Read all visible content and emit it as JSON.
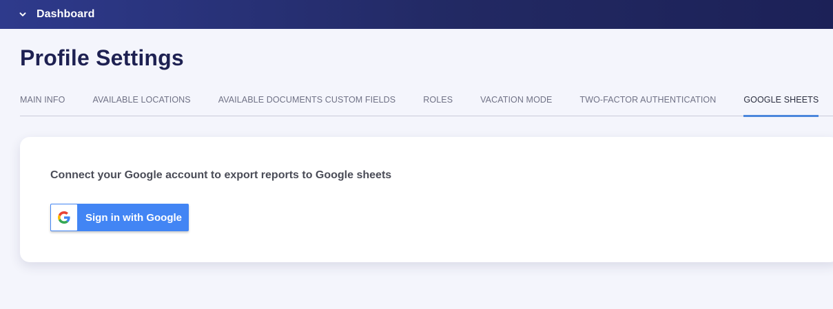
{
  "topbar": {
    "title": "Dashboard",
    "icon": "chevron-down-icon",
    "bg_color": "#222963"
  },
  "page": {
    "title": "Profile Settings"
  },
  "tabs": [
    {
      "label": "MAIN INFO",
      "active": false
    },
    {
      "label": "AVAILABLE LOCATIONS",
      "active": false
    },
    {
      "label": "AVAILABLE DOCUMENTS CUSTOM FIELDS",
      "active": false
    },
    {
      "label": "ROLES",
      "active": false
    },
    {
      "label": "VACATION MODE",
      "active": false
    },
    {
      "label": "TWO-FACTOR AUTHENTICATION",
      "active": false
    },
    {
      "label": "GOOGLE SHEETS",
      "active": true
    }
  ],
  "card": {
    "description": "Connect your Google account to export reports to Google sheets",
    "google_button": {
      "label": "Sign in with Google",
      "icon": "google-g-icon",
      "color": "#4285f4"
    }
  },
  "colors": {
    "accent": "#4a86dc",
    "title": "#1e2152",
    "background": "#f4f5fc"
  }
}
